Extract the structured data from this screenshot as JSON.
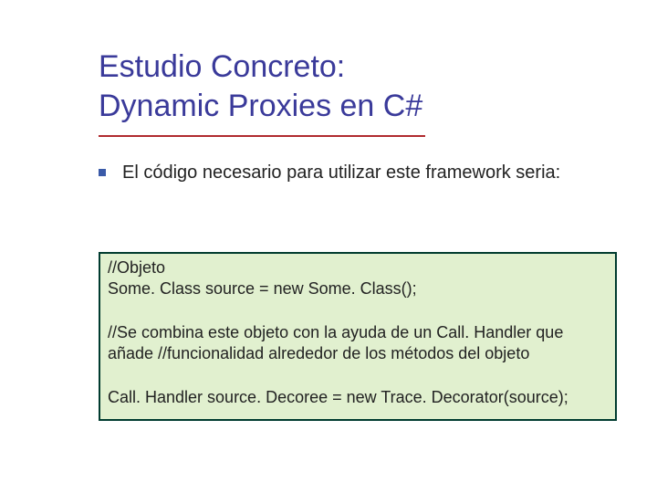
{
  "title": {
    "line1": "Estudio Concreto:",
    "line2": "Dynamic Proxies en C#"
  },
  "bullet": {
    "text": "El código necesario para utilizar este framework seria:"
  },
  "code": {
    "l1": "//Objeto",
    "l2": "Some. Class source = new Some. Class();",
    "l3": "//Se combina este objeto con la ayuda de un Call. Handler que añade //funcionalidad alrededor de los métodos del objeto",
    "l4": "Call. Handler source. Decoree = new Trace. Decorator(source);"
  }
}
